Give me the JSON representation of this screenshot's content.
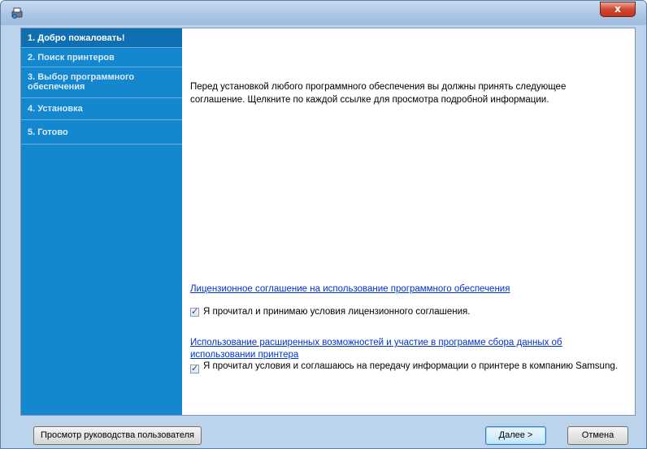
{
  "window": {
    "close_label": "x"
  },
  "sidebar": {
    "steps": [
      {
        "label": "1. Добро пожаловать!"
      },
      {
        "label": "2. Поиск принтеров"
      },
      {
        "label": "3. Выбор программного обеспечения"
      },
      {
        "label": "4. Установка"
      },
      {
        "label": "5. Готово"
      }
    ]
  },
  "main": {
    "intro": "Перед установкой любого программного обеспечения вы должны принять следующее соглашение. Щелкните по каждой ссылке для просмотра подробной информации.",
    "license_link": "Лицензионное соглашение на использование программного обеспечения",
    "license_checkbox": {
      "checked": true,
      "label": "Я прочитал и принимаю условия лицензионного соглашения."
    },
    "data_link": "Использование расширенных возможностей и участие в программе сбора данных об использовании принтера",
    "data_checkbox": {
      "checked": true,
      "label": "Я прочитал условия и соглашаюсь на передачу информации о принтере в компанию Samsung."
    }
  },
  "footer": {
    "manual_button": "Просмотр руководства пользователя",
    "next_button": "Далее >",
    "cancel_button": "Отмена"
  },
  "colors": {
    "sidebar": "#1587cf",
    "sidebar_active": "#0f6fb0",
    "link": "#0033cc"
  }
}
